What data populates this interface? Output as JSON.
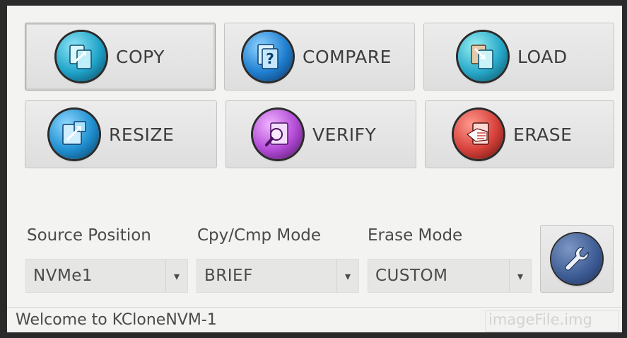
{
  "actions": {
    "copy": {
      "label": "COPY",
      "icon": "copy-icon",
      "color": "#1fa3c8"
    },
    "compare": {
      "label": "COMPARE",
      "icon": "compare-icon",
      "color": "#1f7fd0"
    },
    "load": {
      "label": "LOAD",
      "icon": "load-icon",
      "color": "#27a8c9"
    },
    "resize": {
      "label": "RESIZE",
      "icon": "resize-icon",
      "color": "#1f8fd0"
    },
    "verify": {
      "label": "VERIFY",
      "icon": "verify-icon",
      "color": "#b24ad6"
    },
    "erase": {
      "label": "ERASE",
      "icon": "erase-icon",
      "color": "#d6403a"
    }
  },
  "settings": {
    "source_position": {
      "label": "Source Position",
      "value": "NVMe1"
    },
    "cpy_cmp_mode": {
      "label": "Cpy/Cmp Mode",
      "value": "BRIEF"
    },
    "erase_mode": {
      "label": "Erase Mode",
      "value": "CUSTOM"
    },
    "tools_icon": "wrench-icon"
  },
  "status": {
    "message": "Welcome to KCloneNVM-1",
    "image_file": "imageFile.img"
  }
}
